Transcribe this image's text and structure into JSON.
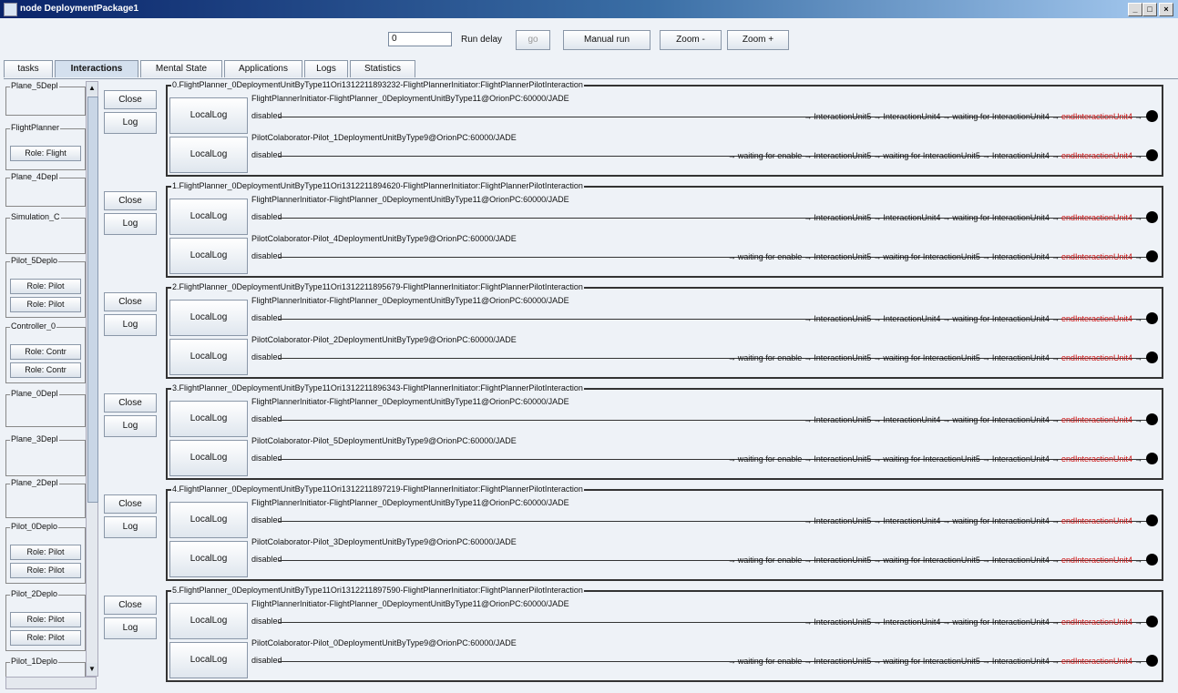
{
  "window": {
    "title": "node DeploymentPackage1",
    "controls": [
      "_",
      "□",
      "×"
    ]
  },
  "toolbar": {
    "input_value": "0",
    "run_delay_label": "Run delay",
    "go": "go",
    "manual_run": "Manual run",
    "zoom_minus": "Zoom -",
    "zoom_plus": "Zoom +"
  },
  "tabs": [
    "tasks",
    "Interactions",
    "Mental State",
    "Applications",
    "Logs",
    "Statistics"
  ],
  "left_groups": [
    {
      "label": "Plane_5Depl",
      "roles": []
    },
    {
      "label": "FlightPlanner",
      "roles": [
        "Role: Flight"
      ]
    },
    {
      "label": "Plane_4Depl",
      "roles": []
    },
    {
      "label": "Simulation_C",
      "roles": []
    },
    {
      "label": "Pilot_5Deplo",
      "roles": [
        "Role: Pilot",
        "Role: Pilot"
      ]
    },
    {
      "label": "Controller_0",
      "roles": [
        "Role: Contr",
        "Role: Contr"
      ]
    },
    {
      "label": "Plane_0Depl",
      "roles": []
    },
    {
      "label": "Plane_3Depl",
      "roles": []
    },
    {
      "label": "Plane_2Depl",
      "roles": []
    },
    {
      "label": "Pilot_0Deplo",
      "roles": [
        "Role: Pilot",
        "Role: Pilot"
      ]
    },
    {
      "label": "Pilot_2Deplo",
      "roles": [
        "Role: Pilot",
        "Role: Pilot"
      ]
    },
    {
      "label": "Pilot_1Deplo",
      "roles": []
    }
  ],
  "buttons": {
    "close": "Close",
    "log": "Log",
    "local_log": "LocalLog"
  },
  "interaction_titles": [
    "0.FlightPlanner_0DeploymentUnitByType11Ori1312211893232-FlightPlannerInitiator:FlightPlannerPilotInteraction",
    "1.FlightPlanner_0DeploymentUnitByType11Ori1312211894620-FlightPlannerInitiator:FlightPlannerPilotInteraction",
    "2.FlightPlanner_0DeploymentUnitByType11Ori1312211895679-FlightPlannerInitiator:FlightPlannerPilotInteraction",
    "3.FlightPlanner_0DeploymentUnitByType11Ori1312211896343-FlightPlannerInitiator:FlightPlannerPilotInteraction",
    "4.FlightPlanner_0DeploymentUnitByType11Ori1312211897219-FlightPlannerInitiator:FlightPlannerPilotInteraction",
    "5.FlightPlanner_0DeploymentUnitByType11Ori1312211897590-FlightPlannerInitiator:FlightPlannerPilotInteraction"
  ],
  "initiator_label": "FlightPlannerInitiator-FlightPlanner_0DeploymentUnitByType11@OrionPC:60000/JADE",
  "collaborators": [
    "PilotColaborator-Pilot_1DeploymentUnitByType9@OrionPC:60000/JADE",
    "PilotColaborator-Pilot_4DeploymentUnitByType9@OrionPC:60000/JADE",
    "PilotColaborator-Pilot_2DeploymentUnitByType9@OrionPC:60000/JADE",
    "PilotColaborator-Pilot_5DeploymentUnitByType9@OrionPC:60000/JADE",
    "PilotColaborator-Pilot_3DeploymentUnitByType9@OrionPC:60000/JADE",
    "PilotColaborator-Pilot_0DeploymentUnitByType9@OrionPC:60000/JADE"
  ],
  "disabled_label": "disabled",
  "flows": {
    "initiator": [
      "InteractionUnit5",
      "InteractionUnit4",
      "waiting for InteractionUnit4",
      "endInteractionUnit4"
    ],
    "collaborator": [
      "waiting for enable",
      "InteractionUnit5",
      "waiting for InteractionUnit5",
      "InteractionUnit4",
      "endInteractionUnit4"
    ]
  },
  "colors": {
    "end_state": "#cc1111",
    "title_bar": "#0a246a"
  }
}
